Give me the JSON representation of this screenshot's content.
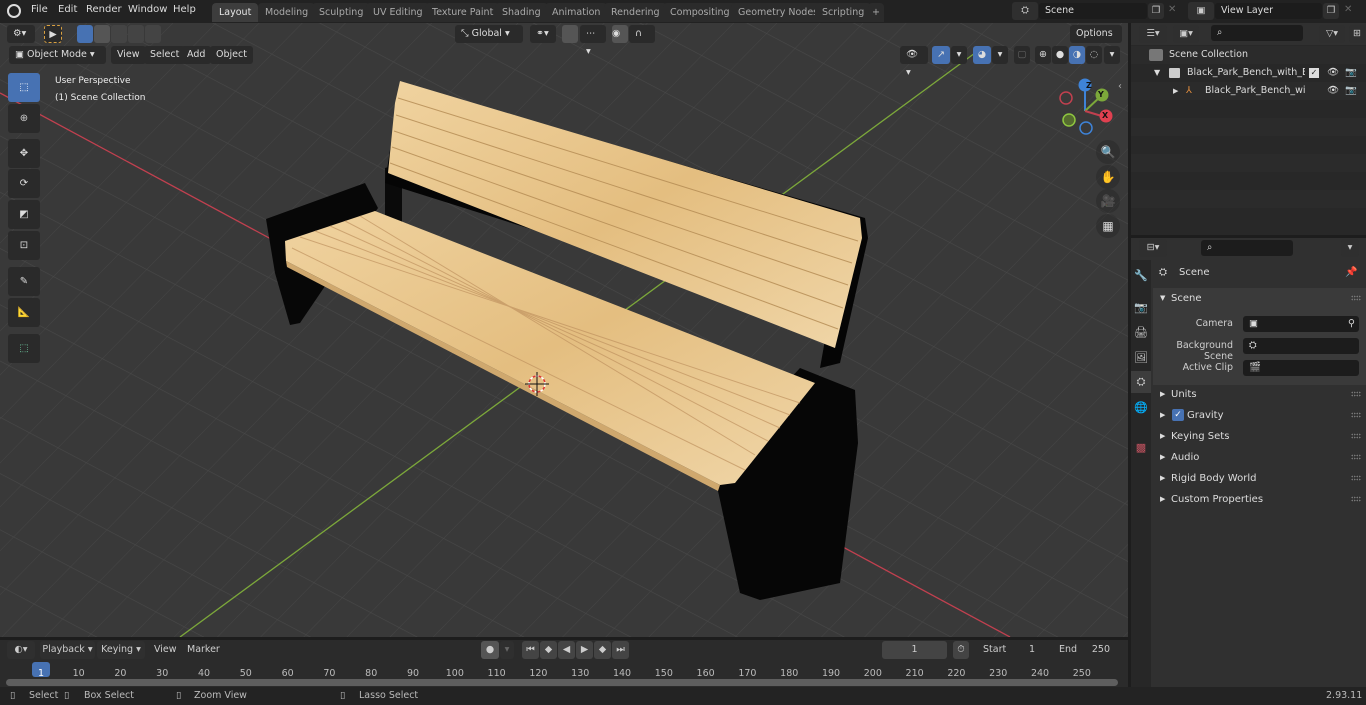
{
  "topbar": {
    "menu": [
      "File",
      "Edit",
      "Render",
      "Window",
      "Help"
    ],
    "workspace_tabs": [
      "Layout",
      "Modeling",
      "Sculpting",
      "UV Editing",
      "Texture Paint",
      "Shading",
      "Animation",
      "Rendering",
      "Compositing",
      "Geometry Nodes",
      "Scripting"
    ],
    "active_tab": "Layout",
    "add_tab": "+",
    "scene_name": "Scene",
    "view_layer": "View Layer"
  },
  "viewport_header": {
    "mode": "Object Mode",
    "menus": [
      "View",
      "Select",
      "Add",
      "Object"
    ],
    "transform_orientation": "Global",
    "options_label": "Options"
  },
  "viewport": {
    "view_name": "User Perspective",
    "collection_info": "(1) Scene Collection",
    "gizmo_axes": [
      "Z",
      "Y",
      "X"
    ],
    "colors": {
      "x_axis": "#c1404f",
      "y_axis": "#7ca83a",
      "z_axis": "#3e83d8",
      "bench_wood": "#e6c48c",
      "bench_frame": "#080808",
      "grid_bg": "#393939"
    }
  },
  "outliner": {
    "root": "Scene Collection",
    "items": [
      {
        "name": "Black_Park_Bench_with_Back",
        "type": "collection",
        "checked": true
      },
      {
        "name": "Black_Park_Bench_with_",
        "type": "empty"
      }
    ]
  },
  "properties": {
    "context_title": "Scene",
    "section": "Scene",
    "fields": [
      {
        "label": "Camera",
        "value": ""
      },
      {
        "label": "Background Scene",
        "value": ""
      },
      {
        "label": "Active Clip",
        "value": ""
      }
    ],
    "subpanels": [
      {
        "label": "Units"
      },
      {
        "label": "Gravity",
        "checkbox": true
      },
      {
        "label": "Keying Sets"
      },
      {
        "label": "Audio"
      },
      {
        "label": "Rigid Body World"
      },
      {
        "label": "Custom Properties"
      }
    ]
  },
  "timeline": {
    "menus": [
      "Playback",
      "Keying",
      "View",
      "Marker"
    ],
    "current_frame": "1",
    "start_label": "Start",
    "start": "1",
    "end_label": "End",
    "end": "250",
    "ticks": [
      "1",
      "10",
      "20",
      "30",
      "40",
      "50",
      "60",
      "70",
      "80",
      "90",
      "100",
      "110",
      "120",
      "130",
      "140",
      "150",
      "160",
      "170",
      "180",
      "190",
      "200",
      "210",
      "220",
      "230",
      "240",
      "250"
    ]
  },
  "statusbar": {
    "hints": [
      "Select",
      "Box Select",
      "Zoom View",
      "Lasso Select"
    ],
    "version": "2.93.11"
  }
}
